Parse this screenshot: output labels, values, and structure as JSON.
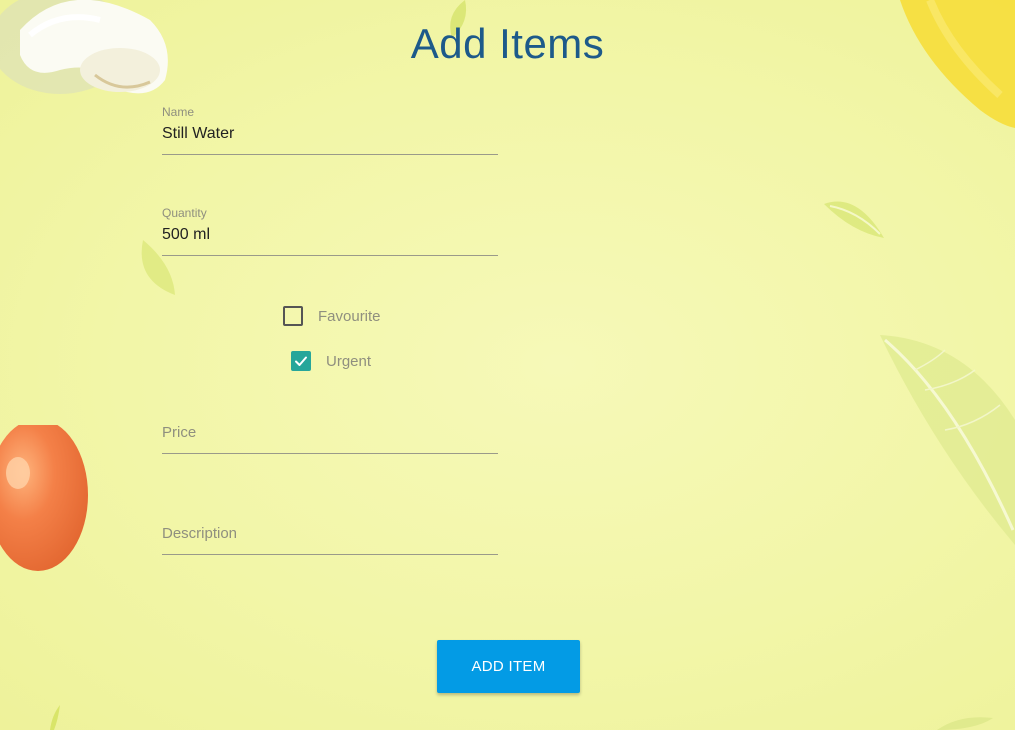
{
  "page": {
    "title": "Add Items"
  },
  "form": {
    "name": {
      "label": "Name",
      "value": "Still Water"
    },
    "quantity": {
      "label": "Quantity",
      "value": "500 ml"
    },
    "favourite": {
      "label": "Favourite",
      "checked": false
    },
    "urgent": {
      "label": "Urgent",
      "checked": true
    },
    "price": {
      "placeholder": "Price",
      "value": ""
    },
    "description": {
      "placeholder": "Description",
      "value": ""
    },
    "submit_label": "ADD ITEM"
  },
  "colors": {
    "background": "#f2f6a8",
    "title": "#1d5a8a",
    "button": "#039be5",
    "checkbox_checked": "#26a69a"
  },
  "decorations": [
    "mushroom-image",
    "leaf-image",
    "tomato-image",
    "lemon-image"
  ]
}
